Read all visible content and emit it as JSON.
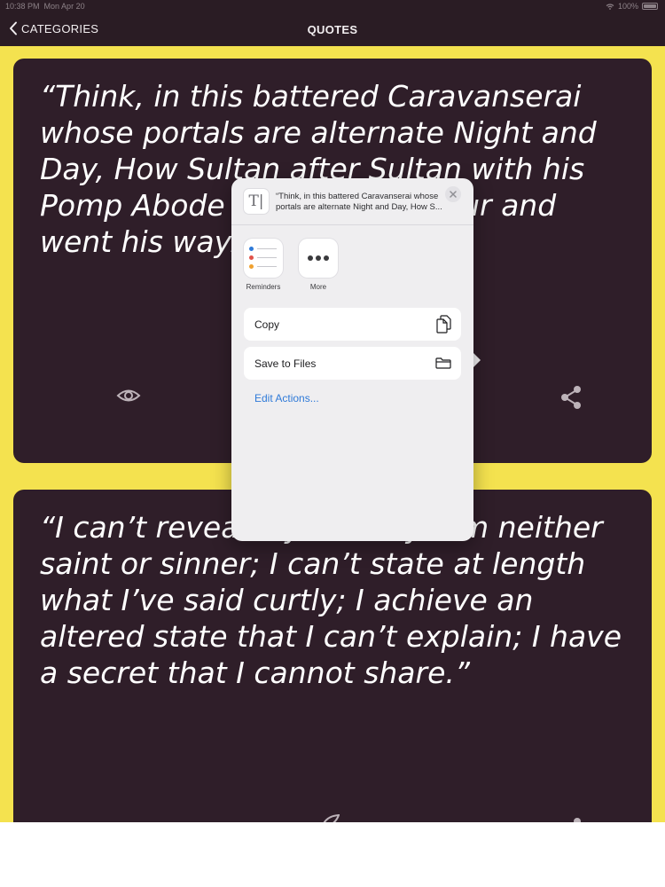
{
  "status_bar": {
    "time": "10:38 PM",
    "date": "Mon Apr 20",
    "battery": "100%"
  },
  "nav": {
    "back_label": "CATEGORIES",
    "title": "QUOTES"
  },
  "quotes": [
    "“Think, in this battered Caravanserai whose portals are alternate Night and Day, How Sultan after Sultan with his Pomp Abode his destined Hour and went his way.”",
    "“I can’t reveal my identity; I’m neither saint or sinner; I can’t state at length what I’ve said curtly; I achieve an altered state that I can’t explain; I have a secret that I cannot share.”"
  ],
  "share_sheet": {
    "preview_text": "“Think, in this battered Caravanserai whose portals are alternate Night and Day, How S...",
    "apps": [
      {
        "label": "Reminders"
      },
      {
        "label": "More"
      }
    ],
    "actions": [
      {
        "label": "Copy"
      },
      {
        "label": "Save to Files"
      }
    ],
    "edit_actions_label": "Edit Actions..."
  },
  "icons": {
    "card_left": "eye-icon",
    "card_right": "share-icon",
    "copy": "copy-icon",
    "save": "folder-icon",
    "close": "close-icon",
    "back": "chevron-left-icon"
  },
  "colors": {
    "background_yellow": "#f4e24f",
    "card": "#2f1e29",
    "nav_bar": "#2a1c24",
    "sheet": "#efeef0",
    "link_blue": "#2f7ad8"
  }
}
